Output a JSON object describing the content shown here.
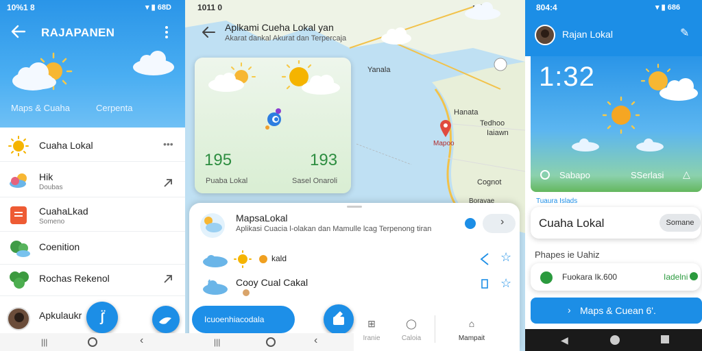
{
  "panel1": {
    "status": {
      "time": "10%1 8",
      "right": "68D"
    },
    "header": {
      "title": "RAJAPANEN"
    },
    "tabs": [
      "Maps & Cuaha",
      "Cerpenta"
    ],
    "list": [
      {
        "title": "Cuaha Lokal",
        "sub": ""
      },
      {
        "title": "Hik",
        "sub": "Doubas"
      },
      {
        "title": "CuahaLkad",
        "sub": "Someno"
      },
      {
        "title": "Coenition",
        "sub": ""
      },
      {
        "title": "Rochas Rekenol",
        "sub": ""
      },
      {
        "title": "Apkulaukr",
        "sub": ""
      }
    ]
  },
  "panel2": {
    "status": {
      "time": "1011 0",
      "right": "..."
    },
    "header": {
      "title": "Aplkami Cueha Lokal yan",
      "subtitle": "Akarat dankal Akurat dan Terpercaja"
    },
    "map_labels": [
      "Yanala",
      "Hanata",
      "Tedhoo",
      "Iaiawn",
      "Mapoo",
      "Cognot",
      "Boravae"
    ],
    "map_card": {
      "left_value": "195",
      "left_label": "Puaba Lokal",
      "right_value": "193",
      "right_label": "Sasel Onaroli"
    },
    "sheet": {
      "items": [
        {
          "title": "MapsaLokal",
          "desc": "Aplikasi Cuacia l-olakan dan Mamulle lcag Terpenong tiran"
        },
        {
          "title": "",
          "desc": "kald"
        },
        {
          "title": "Cooy Cual Cakal",
          "desc": ""
        }
      ],
      "bottom_nav": [
        "Iranie",
        "Caloia",
        "Mampait"
      ],
      "pill_label": "Icuoenhiacodala"
    }
  },
  "panel3": {
    "status": {
      "time": "804:4",
      "right": "686"
    },
    "header": {
      "title": "Rajan Lokal"
    },
    "clock": "1:32",
    "weather_actions": [
      "Sabapo",
      "SSerlasi"
    ],
    "section_link": "Tuaura Islads",
    "cuaha_card": {
      "title": "Cuaha Lokal",
      "button": "Somane"
    },
    "section_title": "Phapes ie Uahiz",
    "entry": {
      "text": "Fuokara Ik.600",
      "badge": "Iadelni"
    },
    "main_button": "Maps & Cuean 6'."
  }
}
